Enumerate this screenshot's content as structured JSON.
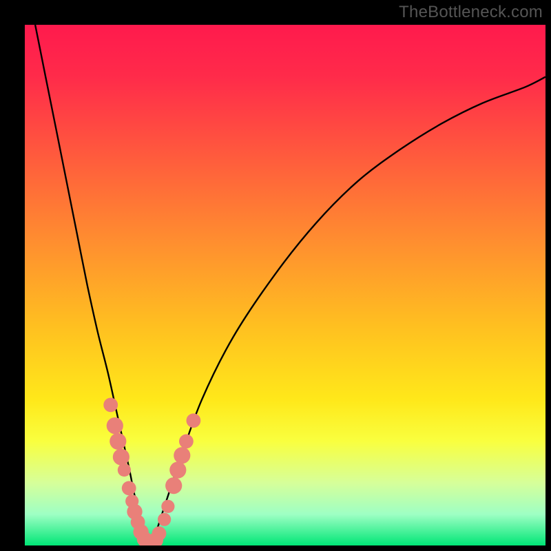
{
  "watermark": "TheBottleneck.com",
  "chart_data": {
    "type": "line",
    "title": "",
    "xlabel": "",
    "ylabel": "",
    "xlim": [
      0,
      100
    ],
    "ylim": [
      0,
      100
    ],
    "grid": false,
    "legend": null,
    "series": [
      {
        "name": "bottleneck-curve",
        "x": [
          2,
          4,
          6,
          8,
          10,
          12,
          14,
          16,
          18,
          20,
          21,
          22,
          23,
          24,
          25,
          27,
          30,
          34,
          40,
          48,
          56,
          64,
          72,
          80,
          88,
          96,
          100
        ],
        "y": [
          100,
          90,
          80,
          70,
          60,
          50,
          41,
          33,
          24,
          15,
          10,
          6,
          2,
          0,
          2,
          8,
          17,
          28,
          40,
          52,
          62,
          70,
          76,
          81,
          85,
          88,
          90
        ]
      }
    ],
    "markers": [
      {
        "x": 16.5,
        "y": 27,
        "r": 1.3
      },
      {
        "x": 17.3,
        "y": 23,
        "r": 1.7
      },
      {
        "x": 17.9,
        "y": 20,
        "r": 1.7
      },
      {
        "x": 18.5,
        "y": 17,
        "r": 1.7
      },
      {
        "x": 19.1,
        "y": 14.5,
        "r": 1.1
      },
      {
        "x": 20.0,
        "y": 11,
        "r": 1.3
      },
      {
        "x": 20.6,
        "y": 8.5,
        "r": 1.1
      },
      {
        "x": 21.1,
        "y": 6.5,
        "r": 1.5
      },
      {
        "x": 21.7,
        "y": 4.5,
        "r": 1.3
      },
      {
        "x": 22.3,
        "y": 2.6,
        "r": 1.5
      },
      {
        "x": 23.0,
        "y": 1.2,
        "r": 1.5
      },
      {
        "x": 23.7,
        "y": 0.6,
        "r": 1.5
      },
      {
        "x": 24.4,
        "y": 0.5,
        "r": 1.5
      },
      {
        "x": 25.1,
        "y": 1.0,
        "r": 1.5
      },
      {
        "x": 25.8,
        "y": 2.3,
        "r": 1.3
      },
      {
        "x": 26.8,
        "y": 5.0,
        "r": 1.1
      },
      {
        "x": 27.5,
        "y": 7.5,
        "r": 1.1
      },
      {
        "x": 28.6,
        "y": 11.5,
        "r": 1.7
      },
      {
        "x": 29.4,
        "y": 14.5,
        "r": 1.7
      },
      {
        "x": 30.2,
        "y": 17.3,
        "r": 1.7
      },
      {
        "x": 31.0,
        "y": 20,
        "r": 1.3
      },
      {
        "x": 32.4,
        "y": 24,
        "r": 1.3
      }
    ],
    "marker_color": "#e98079",
    "curve_color": "#000000",
    "background_gradient": [
      "#ff1a4d",
      "#ffc020",
      "#f9ff3f",
      "#00e676"
    ]
  }
}
